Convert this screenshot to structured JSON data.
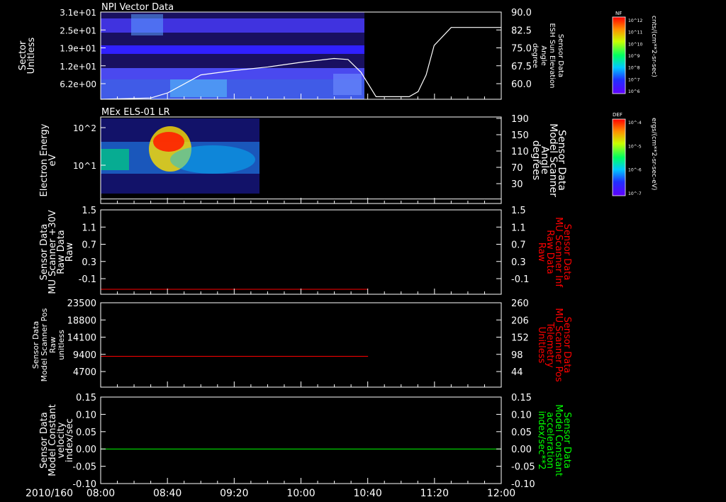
{
  "time": {
    "date_label": "2010/160",
    "ticks": [
      "08:00",
      "08:40",
      "09:20",
      "10:00",
      "10:40",
      "11:20",
      "12:00"
    ],
    "range_hours": [
      8.0,
      12.0
    ]
  },
  "colors": {
    "fg": "#ffffff",
    "red": "#ff0000",
    "green": "#00ff00",
    "bg": "#000000"
  },
  "panels": [
    {
      "id": "npi",
      "title": "NPI Vector Data",
      "left_label": [
        "Sector",
        "Unitless"
      ],
      "left_ticks": [
        "3.1e+01",
        "2.5e+01",
        "1.9e+01",
        "1.2e+01",
        "6.2e+00"
      ],
      "right_label": [
        "Sensor Data",
        "ESH Sun Elevation",
        "Angle",
        "degree"
      ],
      "right_ticks": [
        "90.0",
        "82.5",
        "75.0",
        "67.5",
        "60.0"
      ],
      "colorbar": {
        "tag": "NF",
        "unit": "cnts/(cm**2-sr-sec)",
        "ticks": [
          "10^12",
          "10^11",
          "10^10",
          "10^9",
          "10^8",
          "10^7",
          "10^6"
        ]
      }
    },
    {
      "id": "els",
      "title": "MEx ELS-01 LR",
      "left_label": [
        "Electron Energy",
        "eV"
      ],
      "left_ticks": [
        "10^2",
        "10^1"
      ],
      "right_label": [
        "Sensor Data",
        "Model Scanner",
        "Angle",
        "degrees"
      ],
      "right_ticks": [
        "190",
        "150",
        "110",
        "70",
        "30"
      ],
      "colorbar": {
        "tag": "DEF",
        "unit": "ergs/(cm**2-sr-sec-eV)",
        "ticks": [
          "10^-4",
          "10^-5",
          "10^-6",
          "10^-7"
        ]
      }
    },
    {
      "id": "mu_raw",
      "title": "",
      "left_label": [
        "Sensor Data",
        "MU Scanner +30V",
        "Raw Data",
        "Raw"
      ],
      "left_ticks": [
        "1.5",
        "1.1",
        "0.7",
        "0.3",
        "-0.1"
      ],
      "right_label": [
        "Sensor Data",
        "MU Scanner Inf",
        "Raw Data",
        "Raw"
      ],
      "right_ticks": [
        "1.5",
        "1.1",
        "0.7",
        "0.3",
        "-0.1"
      ]
    },
    {
      "id": "pos",
      "title": "",
      "left_label": [
        "Sensor Data",
        "Model Scanner Pos",
        "Raw",
        "unitless"
      ],
      "left_ticks": [
        "23500",
        "18800",
        "14100",
        "9400",
        "4700"
      ],
      "right_label": [
        "Sensor Data",
        "MU Scanner Pos",
        "Telemetry",
        "Unitless"
      ],
      "right_ticks": [
        "260",
        "206",
        "152",
        "98",
        "44"
      ]
    },
    {
      "id": "vel",
      "title": "",
      "left_label": [
        "Sensor Data",
        "Model Constant",
        "velocity",
        "index/sec"
      ],
      "left_ticks": [
        "0.15",
        "0.10",
        "0.05",
        "0.00",
        "-0.05",
        "-0.10"
      ],
      "right_label": [
        "Sensor Data",
        "Model Constant",
        "acceleration",
        "index/sec**2"
      ],
      "right_ticks": [
        "0.15",
        "0.10",
        "0.05",
        "0.00",
        "-0.05",
        "-0.10"
      ]
    }
  ],
  "chart_data": [
    {
      "type": "line",
      "title": "NPI Vector Data",
      "series": [
        {
          "name": "ESH Sun Elevation Angle",
          "x": [
            8.0,
            8.5,
            8.67,
            9.0,
            9.33,
            9.67,
            10.0,
            10.33,
            10.47,
            10.6,
            10.75,
            10.92,
            11.08,
            11.17,
            11.25,
            11.33,
            11.5,
            12.0
          ],
          "y": [
            56.0,
            56.5,
            58.5,
            65.5,
            67.2,
            68.6,
            70.4,
            71.9,
            71.5,
            66.5,
            57.0,
            57.0,
            57.0,
            59.0,
            65.5,
            77.0,
            84.0,
            84.0
          ]
        }
      ],
      "ylim_left": [
        6.2,
        31.0
      ],
      "ylim_right": [
        56.0,
        90.0
      ]
    },
    {
      "type": "heatmap",
      "title": "MEx ELS-01 LR",
      "x_range_hours": [
        8.0,
        9.62
      ],
      "ylabel": "Electron Energy eV",
      "yscale": "log",
      "series": [
        {
          "name": "Model Scanner Angle",
          "x": [
            8.0,
            12.0
          ],
          "y": [
            10.0,
            10.0
          ]
        }
      ],
      "ylim_right": [
        0,
        190
      ]
    },
    {
      "type": "line",
      "series": [
        {
          "name": "MU Scanner Raw",
          "x": [
            8.0,
            10.67
          ],
          "y": [
            -0.1,
            -0.1
          ]
        }
      ],
      "ylim": [
        -0.2,
        1.5
      ]
    },
    {
      "type": "line",
      "series": [
        {
          "name": "Model Scanner Pos",
          "x": [
            8.0,
            10.67
          ],
          "y": [
            8600,
            8600
          ]
        }
      ],
      "ylim": [
        0,
        23500
      ]
    },
    {
      "type": "line",
      "series": [
        {
          "name": "Model Constant velocity",
          "x": [
            8.0,
            12.0
          ],
          "y": [
            0.0,
            0.0
          ]
        }
      ],
      "ylim": [
        -0.1,
        0.15
      ]
    }
  ]
}
